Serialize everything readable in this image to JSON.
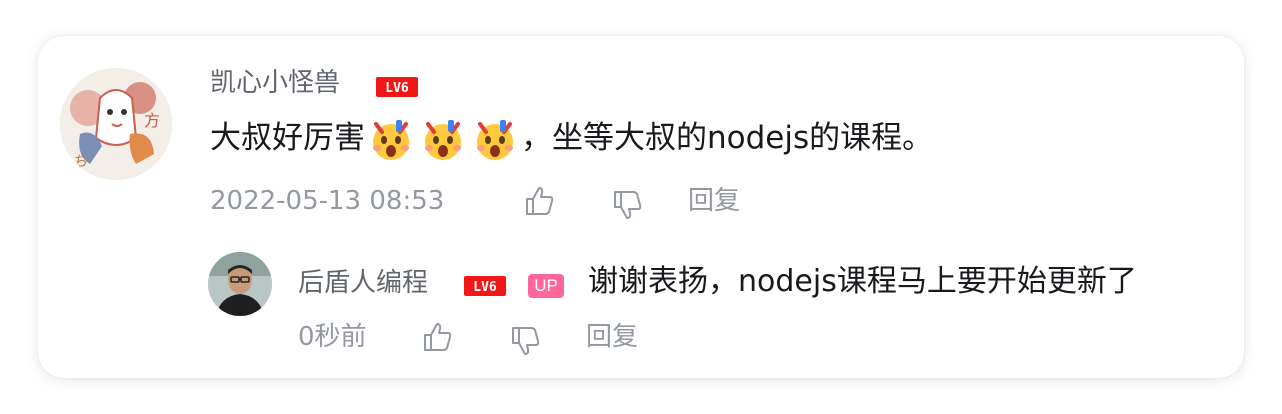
{
  "comment": {
    "username": "凯心小怪兽",
    "level_badge": "LV6",
    "text_before_emoji": "大叔好厉害",
    "emoji_name": "astonished-face-emoji",
    "emoji_count": 3,
    "text_after_emoji": "，坐等大叔的nodejs的课程。",
    "timestamp": "2022-05-13 08:53",
    "like_icon": "thumbs-up-icon",
    "dislike_icon": "thumbs-down-icon",
    "reply_label": "回复"
  },
  "reply": {
    "username": "后盾人编程",
    "level_badge": "LV6",
    "up_badge": "UP",
    "text": "谢谢表扬，nodejs课程马上要开始更新了",
    "timestamp": "0秒前",
    "like_icon": "thumbs-up-icon",
    "dislike_icon": "thumbs-down-icon",
    "reply_label": "回复"
  },
  "colors": {
    "level_badge_red": "#f21717",
    "up_badge_pink": "#ff6699",
    "username_gray": "#61666d",
    "meta_gray": "#9499a0",
    "text_black": "#18191c"
  }
}
